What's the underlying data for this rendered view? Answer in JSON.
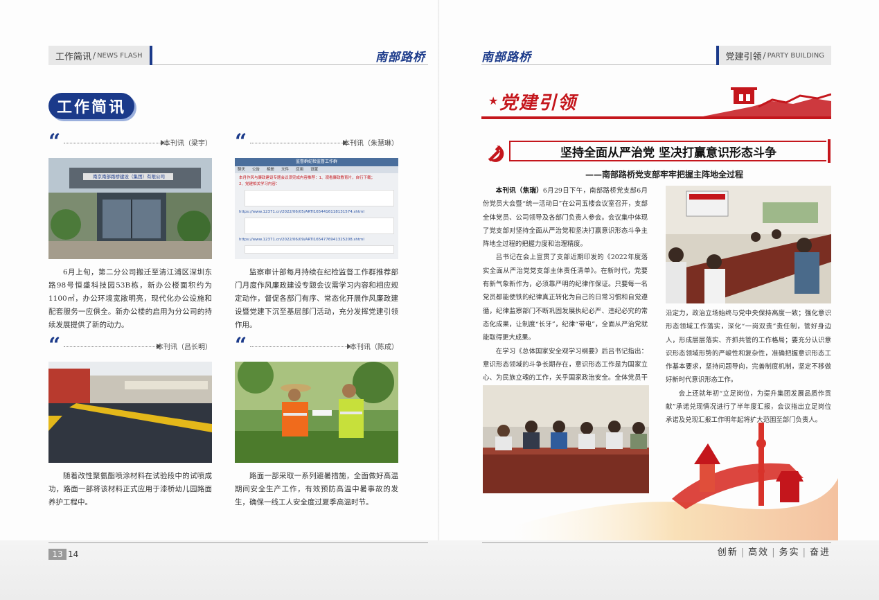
{
  "left": {
    "section_cn": "工作简讯",
    "section_en": "NEWS FLASH",
    "brand": "南部路桥",
    "title": "工作简讯",
    "page_number": "13",
    "news": [
      {
        "byline": "本刊讯（梁宇）",
        "photo_sign": "南京南部路桥建设（集团）有限公司",
        "text": "6月上旬，第二分公司搬迁至清江浦区深圳东路98号恒盛科技园53B栋，新办公楼面积约为1100㎡，办公环境宽敞明亮，现代化办公设施和配套服务一应俱全。新办公楼的启用为分公司的持续发展提供了新的动力。"
      },
      {
        "byline": "本刊讯（朱慧琳）",
        "text": "监察审计部每月持续在纪检监督工作群推荐部门月度作风廉政建设专题会议需学习内容和相应规定动作，督促各部门有序、常态化开展作风廉政建设暨党建下沉至基层部门活动，充分发挥党建引领作用。"
      },
      {
        "byline": "本刊讯（吕长明）",
        "text": "随着改性聚氨酯喷涂材料在试验段中的试喷成功，路面一部将该材料正式应用于漆桥幼儿园路面养护工程中。"
      },
      {
        "byline": "本刊讯（陈成）",
        "text": "路面一部采取一系列避暑措施，全面做好高温期间安全生产工作，有效预防高温中暑事故的发生，确保一线工人安全度过夏季高温时节。"
      }
    ],
    "screenshot": {
      "header": "监督群纪检监督工作群",
      "menu": [
        "聊天",
        "公告",
        "相册",
        "文件",
        "应用",
        "设置"
      ],
      "red_line1": "本月作风与廉政建设专题会议须完成内容推荐：1、观看廉政教育片，自行下载；",
      "red_line2": "2、党建相关学习内容：",
      "link1": "https://www.12371.cn/2022/06/05/ARTI1654416118131574.shtml",
      "link2": "https://www.12371.cn/2022/06/09/ARTI1654776941325208.shtml"
    }
  },
  "right": {
    "section_cn": "党建引领",
    "section_en": "PARTY BUILDING",
    "brand": "南部路桥",
    "banner_title": "党建引领",
    "page_number": "14",
    "article_title": "坚持全面从严治党 坚决打赢意识形态斗争",
    "article_subtitle": "——南部路桥党支部牢牢把握主阵地全过程",
    "byline": "本刊讯（焦瑞）",
    "para1": "6月29日下午，南部路桥党支部6月份党员大会暨“统一活动日”在公司五楼会议室召开，支部全体党员、公司领导及各部门负责人参会。会议集中体现了党支部对坚持全面从严治党和坚决打赢意识形态斗争主阵地全过程的把握力度和治理精度。",
    "para2": "吕书记在会上宣贯了支部近期印发的《2022年度落实全面从严治党党支部主体责任清单》。在新时代，党要有新气象新作为，必须靠严明的纪律作保证。只要每一名党员都能使铁的纪律真正转化为自己的日常习惯和自觉遵循，纪律监察部门不断巩固发展执纪必严、违纪必究的常态化成果，让制度“长牙”，纪律“带电”，全面从严治党就能取得更大成果。",
    "para3": "在学习《总体国家安全观学习纲要》后吕书记指出：意识形态领域的斗争长期存在，意识形态工作是为国家立心、为民族立魂的工作，关乎国家政治安全。全体党员干部在大是大非、重要事项面前要始终保持高度政治清醒和",
    "para4": "定力，政治立场始终与党中央保持高度一致；强化意识形态领域工作落实，深化“一岗双责”责任制，管好身边人，形成层层落实、齐抓共管的工作格局；要充分认识意识形态领域形势的严峻性和复杂性，准确把握意识形态工作基本要求，坚持问题导向，完善制度机制，坚定不移做好新时代意识形态工作。",
    "para4_lead": "沿",
    "para5": "会上还就年初“立足岗位，为提升集团发展品质作贡献”承诺兑现情况进行了半年度汇报，会议指出立足岗位承诺及兑现汇报工作明年起将扩大范围至部门负责人。",
    "motto": [
      "创新",
      "高效",
      "务实",
      "奋进"
    ]
  },
  "colors": {
    "navy": "#1b3a8a",
    "red": "#c4161c"
  }
}
